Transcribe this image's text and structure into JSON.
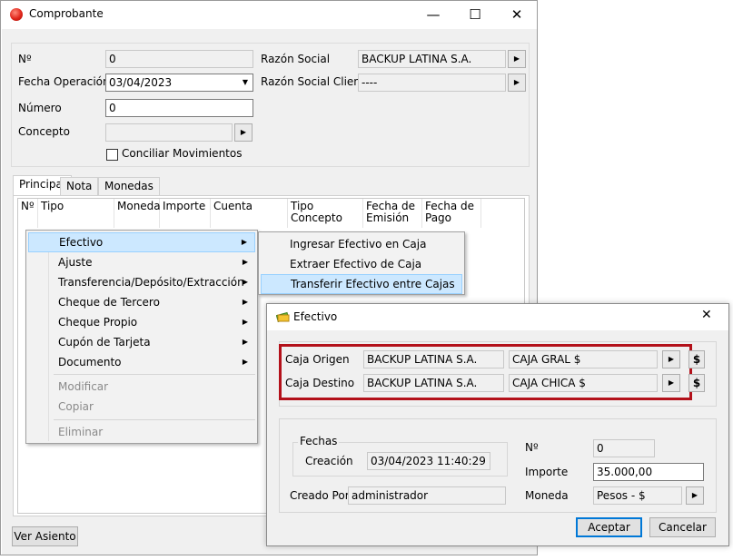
{
  "main_window": {
    "title": "Comprobante",
    "minimize": "—",
    "maximize": "☐",
    "close": "✕"
  },
  "form": {
    "nro_label": "Nº",
    "nro_value": "0",
    "fecha_label": "Fecha Operación",
    "fecha_value": "03/04/2023",
    "numero_label": "Número",
    "numero_value": "0",
    "concepto_label": "Concepto",
    "concepto_value": "",
    "conciliar_label": "Conciliar Movimientos",
    "razon_social_label": "Razón Social",
    "razon_social_value": "BACKUP LATINA S.A.",
    "razon_cliente_label": "Razón Social Cliente",
    "razon_cliente_value": "----"
  },
  "tabs": [
    "Principal",
    "Nota",
    "Monedas"
  ],
  "grid_columns": [
    "Nº",
    "Tipo",
    "Moneda",
    "Importe",
    "Cuenta",
    "Tipo Concepto",
    "Fecha de Emisión",
    "Fecha de Pago"
  ],
  "context_menu": {
    "items": [
      {
        "label": "Efectivo",
        "submenu": true,
        "state": "selected"
      },
      {
        "label": "Ajuste",
        "submenu": true,
        "state": "normal"
      },
      {
        "label": "Transferencia/Depósito/Extracción",
        "submenu": true,
        "state": "normal"
      },
      {
        "label": "Cheque de Tercero",
        "submenu": true,
        "state": "normal"
      },
      {
        "label": "Cheque Propio",
        "submenu": true,
        "state": "normal"
      },
      {
        "label": "Cupón de Tarjeta",
        "submenu": true,
        "state": "normal"
      },
      {
        "label": "Documento",
        "submenu": true,
        "state": "normal"
      },
      {
        "label": "Modificar",
        "submenu": false,
        "state": "disabled"
      },
      {
        "label": "Copiar",
        "submenu": false,
        "state": "disabled"
      },
      {
        "label": "Eliminar",
        "submenu": false,
        "state": "disabled"
      }
    ],
    "arrow": "▶"
  },
  "submenu": {
    "items": [
      "Ingresar Efectivo en Caja",
      "Extraer Efectivo de Caja",
      "Transferir Efectivo entre Cajas"
    ],
    "selected_index": 2
  },
  "footer": {
    "ver_asiento": "Ver Asiento"
  },
  "dialog": {
    "title": "Efectivo",
    "close": "✕",
    "caja_origen_label": "Caja Origen",
    "caja_origen_empresa": "BACKUP LATINA S.A.",
    "caja_origen_caja": "CAJA GRAL $",
    "caja_destino_label": "Caja Destino",
    "caja_destino_empresa": "BACKUP LATINA S.A.",
    "caja_destino_caja": "CAJA CHICA $",
    "dollar": "$",
    "fechas_label": "Fechas",
    "creacion_label": "Creación",
    "creacion_value": "03/04/2023 11:40:29",
    "creado_por_label": "Creado Por",
    "creado_por_value": "administrador",
    "nro_label": "Nº",
    "nro_value": "0",
    "importe_label": "Importe",
    "importe_value": "35.000,00",
    "moneda_label": "Moneda",
    "moneda_value": "Pesos - $",
    "aceptar": "Aceptar",
    "cancelar": "Cancelar"
  },
  "colors": {
    "highlight_box": "#b3111a",
    "menu_selection": "#cce8ff",
    "default_button_border": "#0078d7"
  }
}
